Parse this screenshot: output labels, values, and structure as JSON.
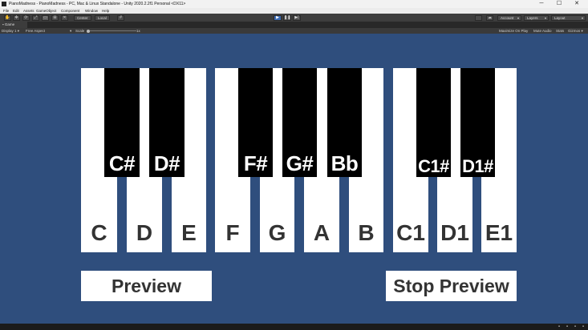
{
  "window": {
    "title": "PianoMadness - PianoMadness - PC, Mac & Linux Standalone - Unity 2020.2.2f1 Personal <DX11>",
    "minimize_glyph": "─",
    "maximize_glyph": "☐",
    "close_glyph": "✕"
  },
  "menu": [
    "File",
    "Edit",
    "Assets",
    "GameObject",
    "Component",
    "Window",
    "Help"
  ],
  "toolbar": {
    "tools": [
      "hand-tool",
      "move-tool",
      "rotate-tool",
      "scale-tool",
      "rect-tool",
      "transform-tool",
      "custom-tool"
    ],
    "tool_glyphs": [
      "✋",
      "✥",
      "⟳",
      "⤢",
      "▭",
      "⊞",
      "✕"
    ],
    "pivot_label": "Center",
    "space_label": "Local",
    "grid_glyph": "#",
    "play_glyph": "▶",
    "pause_glyph": "❚❚",
    "step_glyph": "▶|",
    "collab_glyph": "☁",
    "account_label": "Account",
    "layers_label": "Layers",
    "layout_label": "Layout",
    "caret": "▾"
  },
  "game_tab": {
    "label": "Game",
    "icon": "game-controller-icon"
  },
  "game_controls": {
    "display": "Display 1",
    "aspect": "Free Aspect",
    "scale_label": "Scale",
    "scale_value": "1x",
    "maximize_on_play": "Maximize On Play",
    "mute_audio": "Mute Audio",
    "stats": "Stats",
    "gizmos": "Gizmos"
  },
  "piano": {
    "white_keys": [
      "C",
      "D",
      "E",
      "F",
      "G",
      "A",
      "B",
      "C1",
      "D1",
      "E1"
    ],
    "black_keys": [
      "C#",
      "D#",
      "F#",
      "G#",
      "Bb",
      "C1#",
      "D1#"
    ],
    "key_white_color": "#ffffff",
    "key_black_color": "#000000",
    "background_color": "#2f4e7d"
  },
  "buttons": {
    "preview": "Preview",
    "stop_preview": "Stop Preview"
  },
  "status_icons": [
    "bug-icon",
    "console-icon",
    "collab-icon",
    "settings-icon"
  ]
}
